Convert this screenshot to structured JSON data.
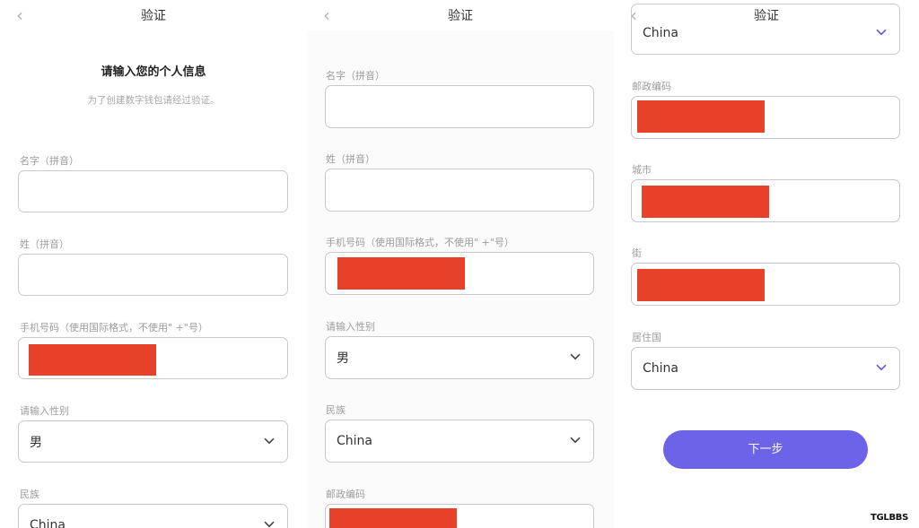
{
  "header": {
    "title": "验证",
    "back_icon": "chevron-left-icon"
  },
  "intro": {
    "heading": "请输入您的个人信息",
    "subheading": "为了创建数字钱包请经过验证。"
  },
  "labels": {
    "first_name": "名字（拼音）",
    "last_name": "姓（拼音）",
    "phone": "手机号码（使用国际格式，不使用\" +\"号）",
    "gender": "请输入性别",
    "ethnicity": "民族",
    "postal_code": "邮政编码",
    "city": "城市",
    "street": "街",
    "country": "居住国"
  },
  "values": {
    "gender": "男",
    "ethnicity": "China",
    "country": "China"
  },
  "buttons": {
    "next": "下一步"
  },
  "watermark": "TGLBBS",
  "colors": {
    "accent": "#6c63e8",
    "redaction": "#e8412a",
    "border": "#c9c9c9"
  }
}
